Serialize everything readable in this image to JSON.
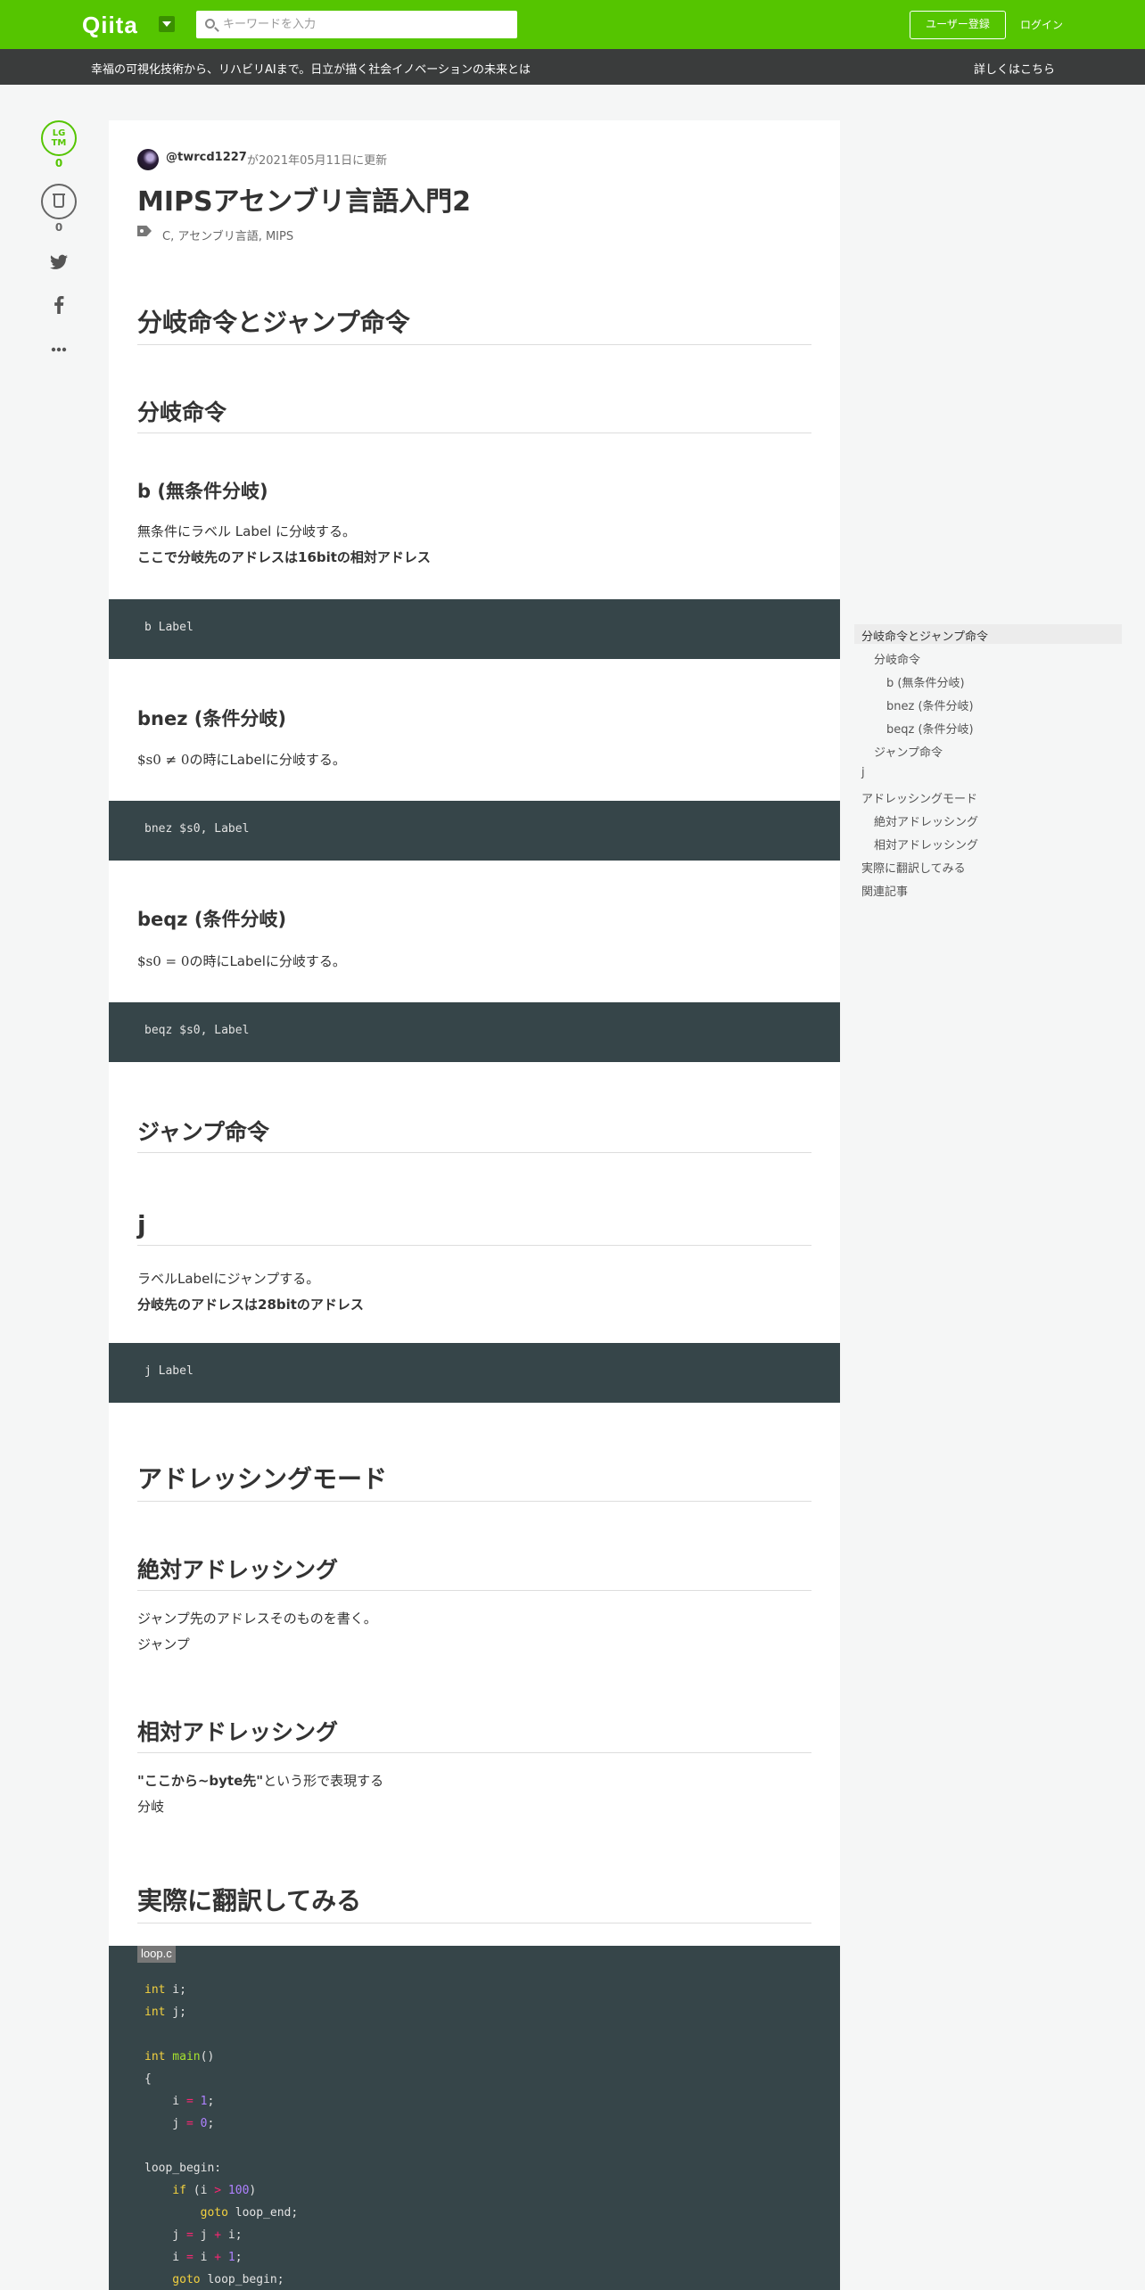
{
  "header": {
    "logo": "Qiita",
    "search_placeholder": "キーワードを入力",
    "signup_label": "ユーザー登録",
    "login_label": "ログイン"
  },
  "banner": {
    "text": "幸福の可視化技術から、リハビリAIまで。日立が描く社会イノベーションの未来とは",
    "link": "詳しくはこちら"
  },
  "actions": {
    "lgtm_line1": "LG",
    "lgtm_line2": "TM",
    "lgtm_count": "0",
    "stock_count": "0"
  },
  "article": {
    "author": "@twrcd1227",
    "updated": "が2021年05月11日に更新",
    "title": "MIPSアセンブリ言語入門2",
    "tags": "C,  アセンブリ言語,  MIPS",
    "sections": {
      "branch_jump": "分岐命令とジャンプ命令",
      "branch": "分岐命令",
      "b_heading": "b (無条件分岐)",
      "b_text1": "無条件にラベル Label に分岐する。",
      "b_text2": "ここで分岐先のアドレスは16bitの相対アドレス",
      "b_code": "b Label",
      "bnez_heading": "bnez (条件分岐)",
      "bnez_math": "$s0 ≠ 0",
      "bnez_text": "の時にLabelに分岐する。",
      "bnez_code": "bnez $s0, Label",
      "beqz_heading": "beqz (条件分岐)",
      "beqz_math": "$s0 = 0",
      "beqz_text": "の時にLabelに分岐する。",
      "beqz_code": "beqz $s0, Label",
      "jump": "ジャンプ命令",
      "j_heading": "j",
      "j_text1": "ラベルLabelにジャンプする。",
      "j_text2": "分岐先のアドレスは28bitのアドレス",
      "j_code": "j Label",
      "addressing": "アドレッシングモード",
      "absolute": "絶対アドレッシング",
      "absolute_text1": "ジャンプ先のアドレスそのものを書く。",
      "absolute_text2": "ジャンプ",
      "relative": "相対アドレッシング",
      "relative_bold": "\"ここから~byte先\"",
      "relative_text1": "という形で表現する",
      "relative_text2": "分岐",
      "translate": "実際に翻訳してみる",
      "code_filename": "loop.c"
    },
    "loop_code": {
      "l1_kw": "int",
      "l1_rest": " i;",
      "l2_kw": "int",
      "l2_rest": " j;",
      "l4_kw": "int",
      "l4_fn": " main",
      "l4_rest": "()",
      "l5": "{",
      "l6_a": "    i ",
      "l6_op": "=",
      "l6_num": " 1",
      "l6_end": ";",
      "l7_a": "    j ",
      "l7_op": "=",
      "l7_num": " 0",
      "l7_end": ";",
      "l9": "loop_begin:",
      "l10_kw": "    if",
      "l10_a": " (i ",
      "l10_op": ">",
      "l10_num": " 100",
      "l10_end": ")",
      "l11_kw": "        goto",
      "l11_rest": " loop_end;",
      "l12_a": "    j ",
      "l12_op": "=",
      "l12_b": " j ",
      "l12_op2": "+",
      "l12_c": " i;",
      "l13_a": "    i ",
      "l13_op": "=",
      "l13_b": " i ",
      "l13_op2": "+",
      "l13_num": " 1",
      "l13_end": ";",
      "l14_kw": "    goto",
      "l14_rest": " loop_begin;"
    }
  },
  "toc": {
    "items": [
      "分岐命令とジャンプ命令",
      "分岐命令",
      "b (無条件分岐)",
      "bnez (条件分岐)",
      "beqz (条件分岐)",
      "ジャンプ命令",
      "j",
      "アドレッシングモード",
      "絶対アドレッシング",
      "相対アドレッシング",
      "実際に翻訳してみる",
      "関連記事"
    ]
  },
  "colors": {
    "brand": "#55c500",
    "banner_bg": "#3a3c3c",
    "code_bg": "#364549"
  },
  "icons": [
    "search-icon",
    "dropdown-icon",
    "lgtm-icon",
    "stock-icon",
    "twitter-icon",
    "facebook-icon",
    "more-icon",
    "tags-icon"
  ]
}
